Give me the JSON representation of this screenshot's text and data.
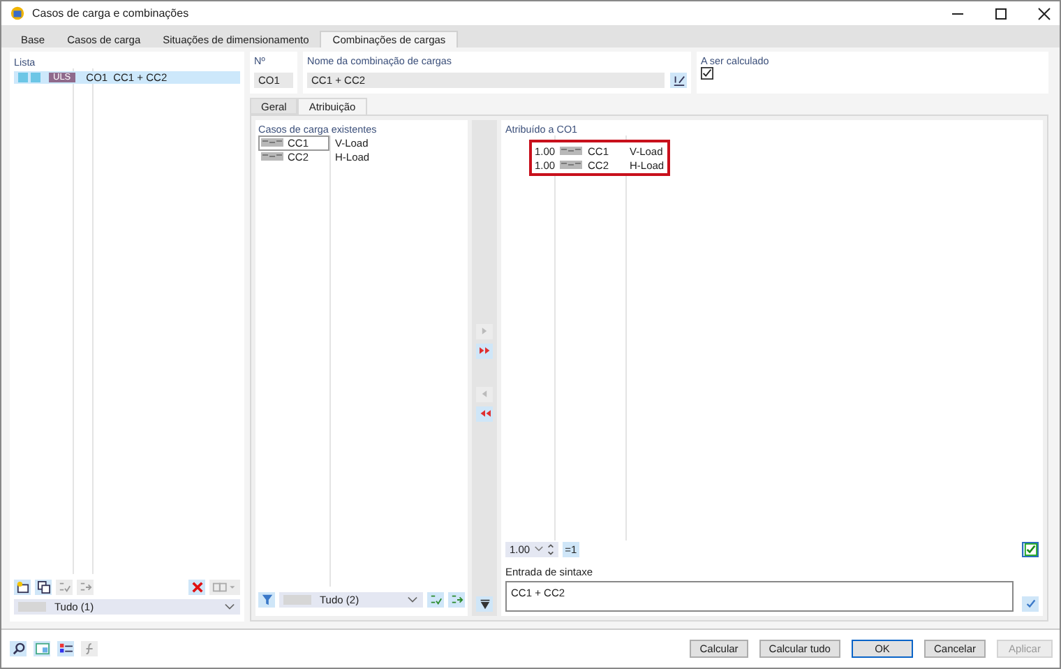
{
  "window": {
    "title": "Casos de carga e combinações"
  },
  "tabs": [
    {
      "label": "Base",
      "selected": false
    },
    {
      "label": "Casos de carga",
      "selected": false
    },
    {
      "label": "Situações de dimensionamento",
      "selected": false
    },
    {
      "label": "Combinações de cargas",
      "selected": true
    }
  ],
  "list": {
    "label": "Lista",
    "items": [
      {
        "badge": "ULS",
        "id": "CO1",
        "name": "CC1 + CC2",
        "selected": true
      }
    ],
    "filter": "Tudo (1)"
  },
  "number": {
    "label": "Nº",
    "value": "CO1"
  },
  "combination_name": {
    "label": "Nome da combinação de cargas",
    "value": "CC1 + CC2"
  },
  "to_calculate": {
    "label": "A ser calculado",
    "checked": true
  },
  "subtabs": [
    {
      "label": "Geral",
      "selected": false
    },
    {
      "label": "Atribuição",
      "selected": true
    }
  ],
  "existing": {
    "label": "Casos de carga existentes",
    "rows": [
      {
        "id": "CC1",
        "name": "V-Load",
        "selected": true
      },
      {
        "id": "CC2",
        "name": "H-Load",
        "selected": false
      }
    ],
    "filter": "Tudo (2)"
  },
  "assigned": {
    "label": "Atribuído a CO1",
    "rows": [
      {
        "factor": "1.00",
        "id": "CC1",
        "name": "V-Load"
      },
      {
        "factor": "1.00",
        "id": "CC2",
        "name": "H-Load"
      }
    ],
    "factor_value": "1.00",
    "set_one": "=1"
  },
  "syntax": {
    "label": "Entrada de sintaxe",
    "value": "CC1 + CC2"
  },
  "buttons": [
    {
      "label": "Calcular",
      "default": false,
      "disabled": false
    },
    {
      "label": "Calcular tudo",
      "default": false,
      "disabled": false
    },
    {
      "label": "OK",
      "default": true,
      "disabled": false
    },
    {
      "label": "Cancelar",
      "default": false,
      "disabled": false
    },
    {
      "label": "Aplicar",
      "default": false,
      "disabled": true
    }
  ]
}
